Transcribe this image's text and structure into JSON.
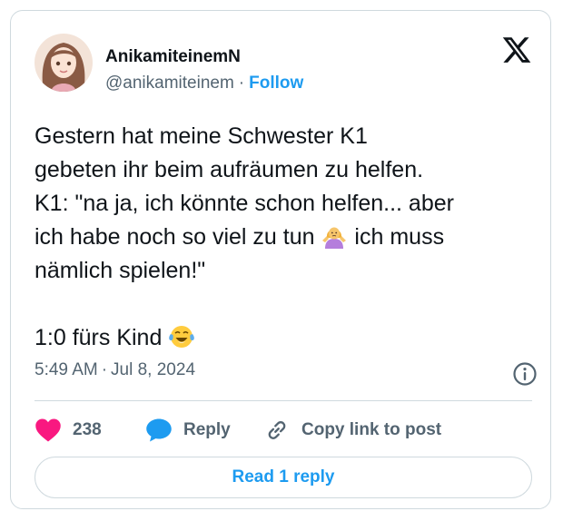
{
  "author": {
    "display_name": "AnikamiteinemN",
    "handle": "@anikamiteinem",
    "separator": "·",
    "follow_label": "Follow"
  },
  "tweet": {
    "line1": "Gestern hat meine Schwester K1",
    "line2": "gebeten ihr beim aufräumen zu helfen.",
    "line3": "K1: \"na ja, ich könnte schon helfen... aber",
    "line4_before": "ich habe noch so viel zu tun ",
    "line4_after": " ich muss",
    "line5": "nämlich spielen!\"",
    "line7": "1:0 fürs Kind "
  },
  "meta": {
    "time": "5:49 AM",
    "separator": "·",
    "date": "Jul 8, 2024"
  },
  "actions": {
    "like_count": "238",
    "reply_label": "Reply",
    "copy_label": "Copy link to post"
  },
  "read_reply_label": "Read 1 reply",
  "colors": {
    "accent": "#1d9bf0",
    "like": "#f91880",
    "text": "#0f1419",
    "muted": "#536471",
    "border": "#cfd9de"
  },
  "icons": {
    "logo": "x-logo-icon",
    "info": "info-icon",
    "like": "heart-icon",
    "reply": "speech-bubble-icon",
    "copy": "link-icon",
    "emoji_shrug": "woman-shrugging-emoji",
    "emoji_laugh": "tears-of-joy-emoji"
  }
}
